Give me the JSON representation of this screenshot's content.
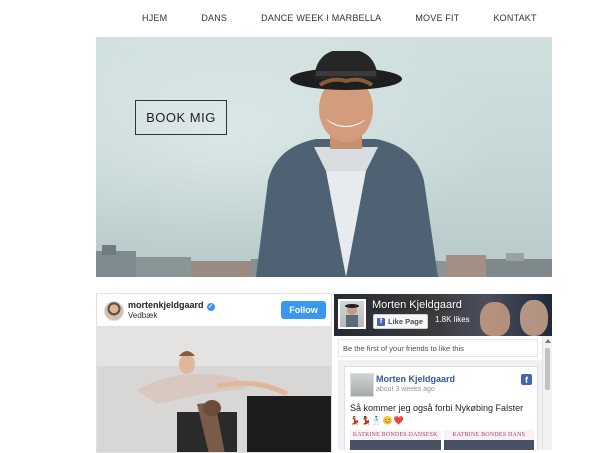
{
  "nav": {
    "items": [
      "HJEM",
      "DANS",
      "DANCE WEEK I MARBELLA",
      "MOVE FIT",
      "KONTAKT"
    ]
  },
  "hero": {
    "button_label": "BOOK MIG"
  },
  "instagram": {
    "username": "mortenkjeldgaard",
    "verified_icon": "✓",
    "location": "Vedbæk",
    "follow_label": "Follow",
    "accent_color": "#3897f0"
  },
  "facebook": {
    "page_name": "Morten Kjeldgaard",
    "like_button_label": "Like Page",
    "likes_count": "1.8K likes",
    "friends_text": "Be the first of your friends to like this",
    "post": {
      "author": "Morten Kjeldgaard",
      "time": "about 3 weeks ago",
      "text": "Så kommer jeg også forbi Nykøbing Falster",
      "emoji": "💃🏻💃🏾🕺🏻😊❤️",
      "image_captions": [
        "KATRINE BONDES DANSESK",
        "KATRINE BONDES DANS"
      ]
    },
    "brand_color": "#4267b2"
  }
}
